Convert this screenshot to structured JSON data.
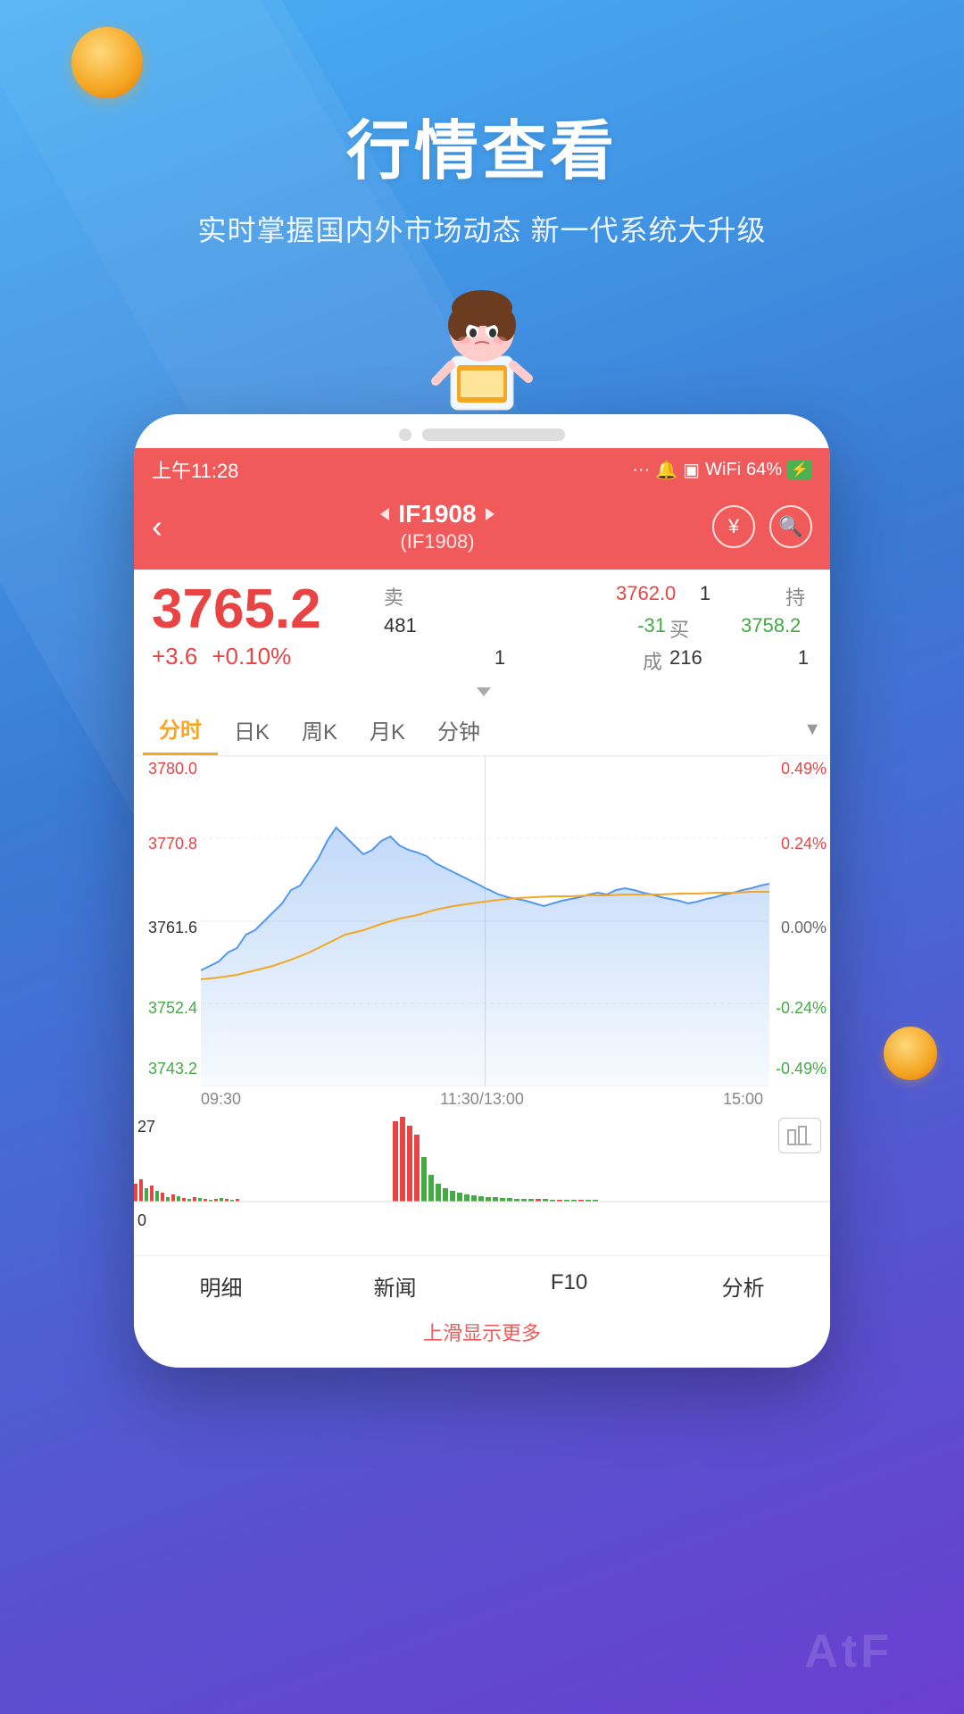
{
  "hero": {
    "title": "行情查看",
    "subtitle": "实时掌握国内外市场动态 新一代系统大升级"
  },
  "status_bar": {
    "time": "上午11:28",
    "battery": "64%"
  },
  "nav": {
    "back_label": "‹",
    "symbol": "IF1908",
    "symbol_sub": "(IF1908)",
    "yuan_icon": "¥",
    "search_icon": "🔍"
  },
  "price": {
    "main": "3765.2",
    "change_abs": "+3.6",
    "change_pct": "+0.10%",
    "sell_label": "卖",
    "sell_price": "3762.0",
    "sell_qty": "1",
    "hold_label": "持",
    "hold_val": "481",
    "hold_change": "-31",
    "buy_label": "买",
    "buy_price": "3758.2",
    "buy_qty": "1",
    "volume_label": "成",
    "volume_val": "216",
    "volume_change": "1"
  },
  "chart_tabs": {
    "tabs": [
      "分时",
      "日K",
      "周K",
      "月K",
      "分钟"
    ],
    "active": "分时"
  },
  "chart": {
    "y_labels_left": [
      {
        "val": "3780.0",
        "color": "red",
        "pct_pos": 2
      },
      {
        "val": "3770.8",
        "color": "red",
        "pct_pos": 27
      },
      {
        "val": "3761.6",
        "color": "black",
        "pct_pos": 52
      },
      {
        "val": "3752.4",
        "color": "green",
        "pct_pos": 77
      },
      {
        "val": "3743.2",
        "color": "green",
        "pct_pos": 95
      }
    ],
    "y_labels_right": [
      {
        "val": "0.49%",
        "color": "red",
        "pct_pos": 2
      },
      {
        "val": "0.24%",
        "color": "red",
        "pct_pos": 27
      },
      {
        "val": "0.00%",
        "color": "gray",
        "pct_pos": 52
      },
      {
        "val": "-0.24%",
        "color": "green",
        "pct_pos": 77
      },
      {
        "val": "-0.49%",
        "color": "green",
        "pct_pos": 95
      }
    ],
    "x_labels": [
      "09:30",
      "11:30/13:00",
      "15:00"
    ],
    "volume_top": "27",
    "volume_bottom": "0"
  },
  "bottom_tabs": [
    "明细",
    "新闻",
    "F10",
    "分析"
  ],
  "scroll_hint": "上滑显示更多",
  "brand": "AtF"
}
